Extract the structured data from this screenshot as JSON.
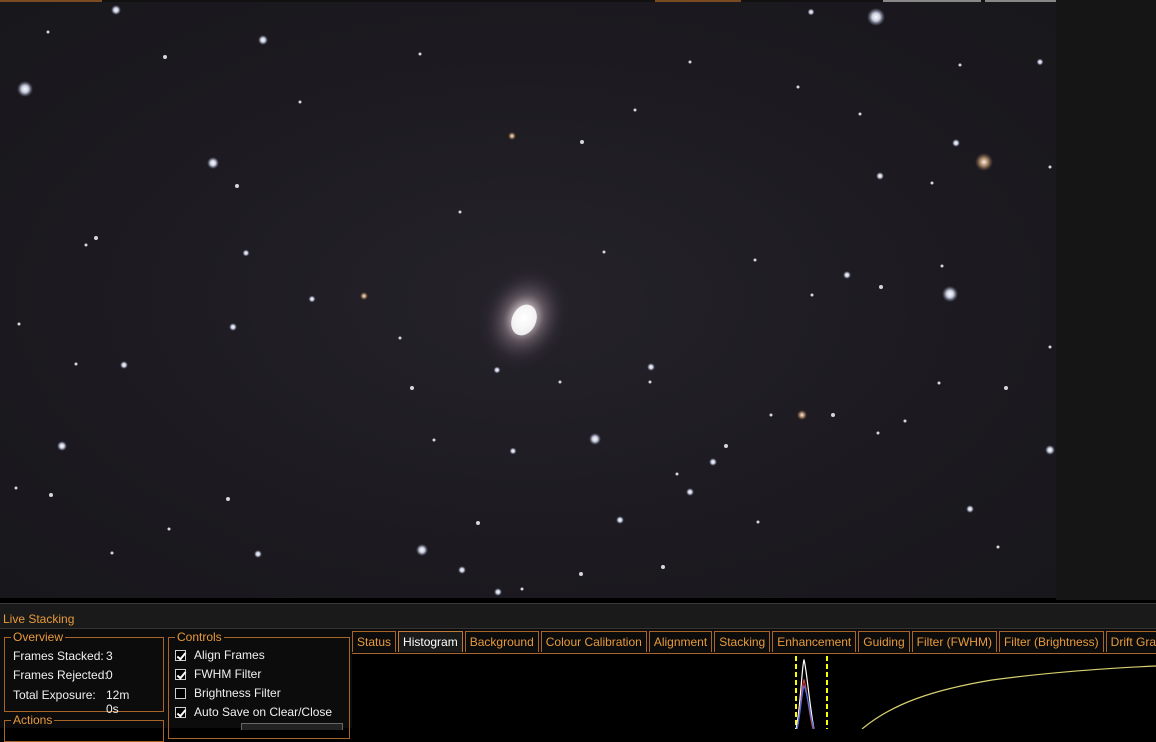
{
  "panel": {
    "title": "Live Stacking"
  },
  "overview": {
    "label": "Overview",
    "frames_stacked_label": "Frames Stacked:",
    "frames_stacked_value": "3",
    "frames_rejected_label": "Frames Rejected:",
    "frames_rejected_value": "0",
    "total_exposure_label": "Total Exposure:",
    "total_exposure_value": "12m 0s"
  },
  "actions": {
    "label": "Actions"
  },
  "controls": {
    "label": "Controls",
    "items": [
      {
        "label": "Align Frames",
        "checked": true
      },
      {
        "label": "FWHM Filter",
        "checked": true
      },
      {
        "label": "Brightness Filter",
        "checked": false
      },
      {
        "label": "Auto Save on Clear/Close",
        "checked": true
      }
    ]
  },
  "tabs": [
    {
      "label": "Status",
      "active": false
    },
    {
      "label": "Histogram",
      "active": true
    },
    {
      "label": "Background",
      "active": false
    },
    {
      "label": "Colour Calibration",
      "active": false
    },
    {
      "label": "Alignment",
      "active": false
    },
    {
      "label": "Stacking",
      "active": false
    },
    {
      "label": "Enhancement",
      "active": false
    },
    {
      "label": "Guiding",
      "active": false
    },
    {
      "label": "Filter (FWHM)",
      "active": false
    },
    {
      "label": "Filter (Brightness)",
      "active": false
    },
    {
      "label": "Drift Graph",
      "active": false
    }
  ],
  "colors": {
    "accent": "#e89a3c",
    "border": "#a8652a",
    "background": "#0c0c0c",
    "histogram_curve": "#d8d070",
    "histogram_marker": "#ffff00"
  }
}
